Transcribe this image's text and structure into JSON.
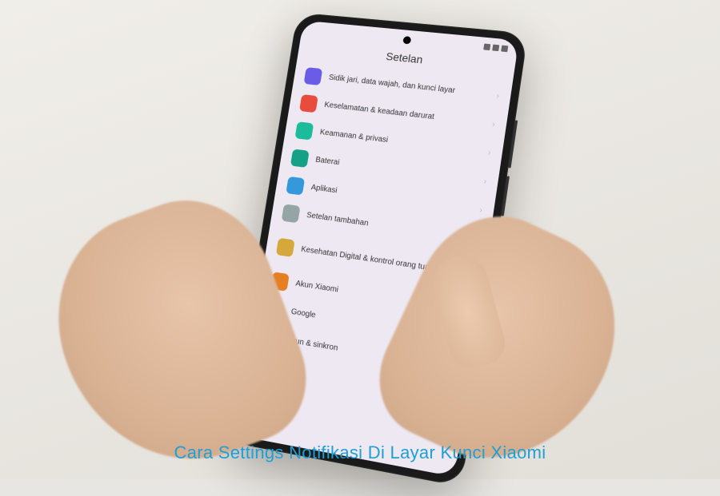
{
  "screen": {
    "title": "Setelan"
  },
  "settings": {
    "items": [
      {
        "label": "Sidik jari, data wajah, dan kunci layar",
        "color": "#6b5ce7"
      },
      {
        "label": "Keselamatan & keadaan darurat",
        "color": "#e74c3c"
      },
      {
        "label": "Keamanan & privasi",
        "color": "#1abc9c"
      },
      {
        "label": "Baterai",
        "color": "#16a085"
      },
      {
        "label": "Aplikasi",
        "color": "#3498db"
      },
      {
        "label": "Setelan tambahan",
        "color": "#95a5a6"
      },
      {
        "label": "Kesehatan Digital & kontrol orang tua",
        "color": "#d4a83a"
      },
      {
        "label": "Akun Xiaomi",
        "color": "#e67e22"
      },
      {
        "label": "Google",
        "color": "#ffffff"
      },
      {
        "label": "Akun & sinkron",
        "color": "#27ae60"
      }
    ]
  },
  "caption": "Cara Settings Notifikasi Di Layar Kunci Xiaomi"
}
